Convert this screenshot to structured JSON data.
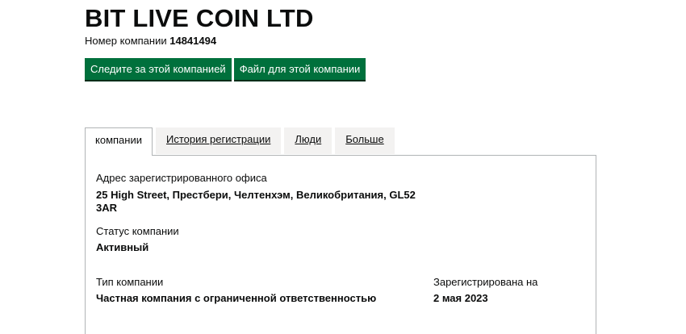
{
  "company": {
    "name": "BIT LIVE COIN LTD",
    "number_label": "Номер компании",
    "number": "14841494"
  },
  "actions": {
    "follow_label": "Следите за этой компанией",
    "filing_label": "Файл для этой компании"
  },
  "tabs": [
    {
      "label": "компании",
      "active": true
    },
    {
      "label": "История регистрации",
      "active": false
    },
    {
      "label": "Люди",
      "active": false
    },
    {
      "label": "Больше",
      "active": false
    }
  ],
  "overview": {
    "office_label": "Адрес зарегистрированного офиса",
    "office_line1": "25 High Street, Престбери, Челтенхэм, Великобритания, GL52",
    "office_line2": "3AR",
    "status_label": "Статус компании",
    "status_value": "Активный",
    "type_label": "Тип компании",
    "type_value": "Частная компания с ограниченной ответственностью",
    "incorporated_label": "Зарегистрирована на",
    "incorporated_value": "2 мая 2023"
  },
  "colors": {
    "button_green": "#00703c",
    "tab_inactive_bg": "#f3f2f1",
    "border": "#b1b4b6",
    "text": "#0b0c0c"
  }
}
